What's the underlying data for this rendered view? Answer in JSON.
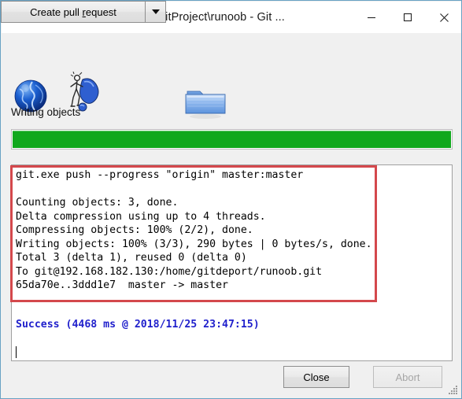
{
  "window": {
    "title": "C:\\Users\\Luolei\\Desktop\\GitProject\\runoob - Git ...",
    "title_icon": "tortoisegit-icon",
    "minimize_label": "—",
    "maximize_label": "□",
    "close_label": "✕",
    "frame_color": "#68a2c4",
    "background_color": "#f0f0f0"
  },
  "icons": {
    "globe": "globe-icon",
    "animation": "transfer-animation-icon",
    "folder": "folder-icon"
  },
  "progress": {
    "status_label": "Writing objects",
    "percent": 100,
    "fill_color": "#10a81c"
  },
  "log": {
    "text": "git.exe push --progress \"origin\" master:master\n\nCounting objects: 3, done.\nDelta compression using up to 4 threads.\nCompressing objects: 100% (2/2), done.\nWriting objects: 100% (3/3), 290 bytes | 0 bytes/s, done.\nTotal 3 (delta 1), reused 0 (delta 0)\nTo git@192.168.182.130:/home/gitdeport/runoob.git\n65da70e..3ddd1e7  master -> master",
    "lines": [
      "git.exe push --progress \"origin\" master:master",
      "",
      "Counting objects: 3, done.",
      "Delta compression using up to 4 threads.",
      "Compressing objects: 100% (2/2), done.",
      "Writing objects: 100% (3/3), 290 bytes | 0 bytes/s, done.",
      "Total 3 (delta 1), reused 0 (delta 0)",
      "To git@192.168.182.130:/home/gitdeport/runoob.git",
      "65da70e..3ddd1e7  master -> master"
    ],
    "success_line": "Success (4468 ms @ 2018/11/25 23:47:15)",
    "success_color": "#2020cc"
  },
  "annotation": {
    "color": "#d4484c"
  },
  "buttons": {
    "pull_request_prefix": "Create pull ",
    "pull_request_mnemonic": "r",
    "pull_request_suffix": "equest",
    "pull_request_full": "Create pull request",
    "dropdown_icon": "chevron-down-icon",
    "close": "Close",
    "abort": "Abort",
    "abort_disabled": true
  }
}
